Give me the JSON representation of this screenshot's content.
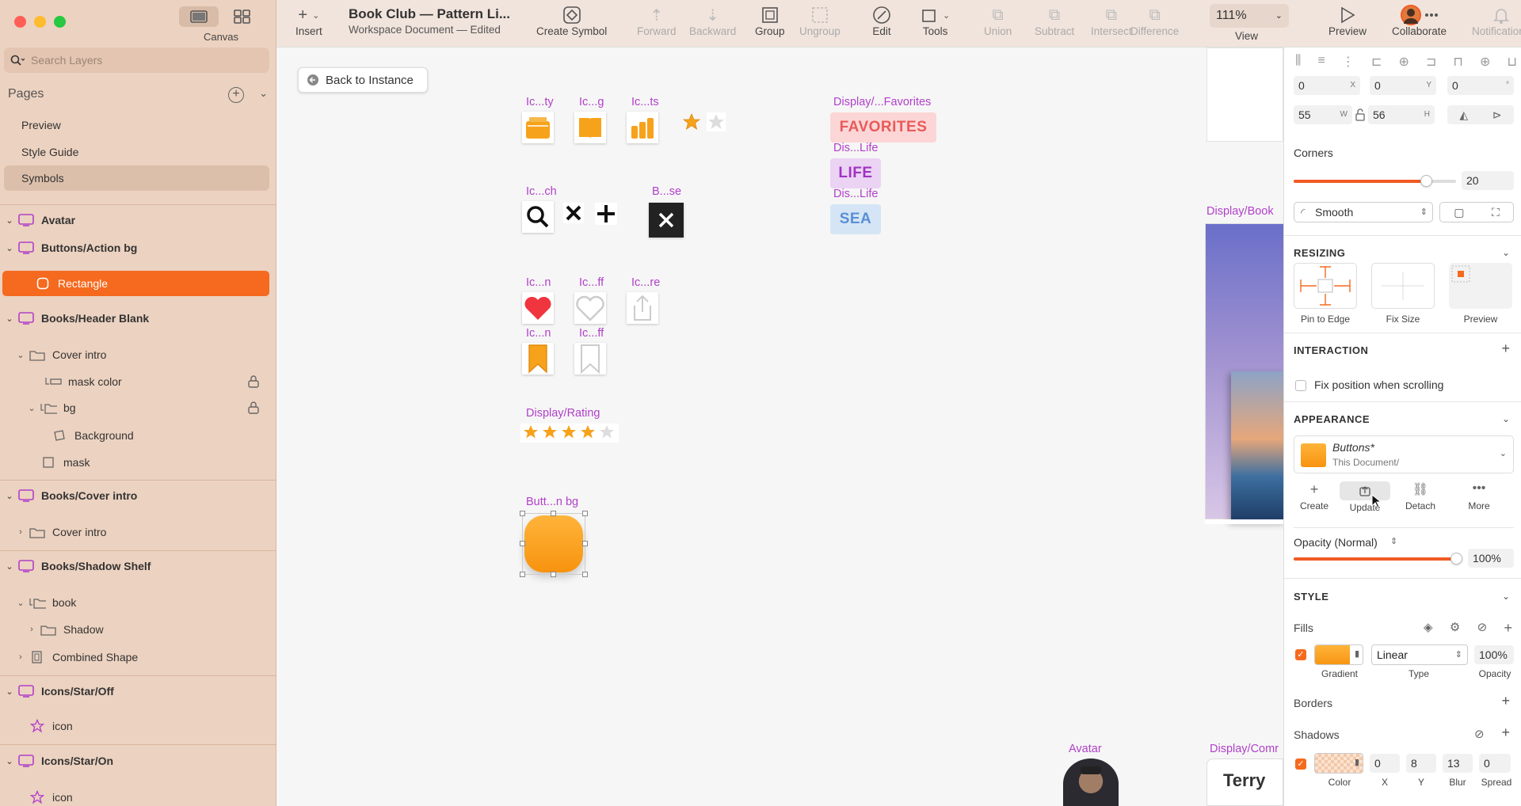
{
  "app": {
    "canvas_label": "Canvas",
    "search_placeholder": "Search Layers"
  },
  "pages": {
    "title": "Pages",
    "items": [
      "Preview",
      "Style Guide",
      "Symbols"
    ]
  },
  "layers": [
    "Avatar",
    "Buttons/Action bg",
    "Rectangle",
    "Books/Header Blank",
    "Cover intro",
    "mask color",
    "bg",
    "Background",
    "mask",
    "Books/Cover intro",
    "Cover intro",
    "Books/Shadow Shelf",
    "book",
    "Shadow",
    "Combined Shape",
    "Icons/Star/Off",
    "icon",
    "Icons/Star/On",
    "icon"
  ],
  "toolbar": {
    "insert": "Insert",
    "doc_title": "Book Club — Pattern Li...",
    "doc_sub": "Workspace Document — Edited",
    "create_symbol": "Create Symbol",
    "forward": "Forward",
    "backward": "Backward",
    "group": "Group",
    "ungroup": "Ungroup",
    "edit": "Edit",
    "tools": "Tools",
    "union": "Union",
    "subtract": "Subtract",
    "intersect": "Intersect",
    "difference": "Difference",
    "zoom": "111%",
    "view": "View",
    "preview": "Preview",
    "collaborate": "Collaborate",
    "notifications": "Notifications"
  },
  "canvas": {
    "back": "Back to Instance",
    "labels": [
      "Ic...ty",
      "Ic...g",
      "Ic...ts",
      "Ic...ch",
      "B...se",
      "Ic...n",
      "Ic...ff",
      "Ic...re",
      "Ic...n",
      "Ic...ff",
      "Display/Rating",
      "Butt...n bg",
      "Display/...Favorites",
      "Dis...Life",
      "Dis...Life",
      "Display/Book",
      "Avatar",
      "Display/Comr"
    ],
    "tags": [
      "FAVORITES",
      "LIFE",
      "SEA"
    ],
    "comment_name": "Terry",
    "rating": 4
  },
  "inspector": {
    "x": "0",
    "y": "0",
    "rot": "0",
    "w": "55",
    "h": "56",
    "ux": "X",
    "uy": "Y",
    "urot": "°",
    "uw": "W",
    "uh": "H",
    "corners": "Corners",
    "corner_value": "20",
    "corner_style": "Smooth",
    "resizing": "RESIZING",
    "pin": "Pin to Edge",
    "fix": "Fix Size",
    "preview": "Preview",
    "interaction": "INTERACTION",
    "fix_scroll": "Fix position when scrolling",
    "appearance": "APPEARANCE",
    "style_name": "Buttons*",
    "style_src": "This Document/",
    "create": "Create",
    "update": "Update",
    "detach": "Detach",
    "more": "More",
    "opacity_lbl": "Opacity (Normal)",
    "opacity": "100%",
    "opacity_frac": 1.0,
    "style": "STYLE",
    "fills": "Fills",
    "fill_type": "Linear",
    "fill_opacity": "100%",
    "gradient": "Gradient",
    "type": "Type",
    "opacity_small": "Opacity",
    "borders": "Borders",
    "shadows": "Shadows",
    "sh_x": "0",
    "sh_y": "8",
    "sh_blur": "13",
    "sh_spread": "0",
    "sh_color": "Color",
    "sh_lx": "X",
    "sh_ly": "Y",
    "sh_lblur": "Blur",
    "sh_lspread": "Spread"
  },
  "colors": {
    "accent": "#f56a1e",
    "symbol_label": "#b140c9",
    "orange": "#f7a21b"
  }
}
